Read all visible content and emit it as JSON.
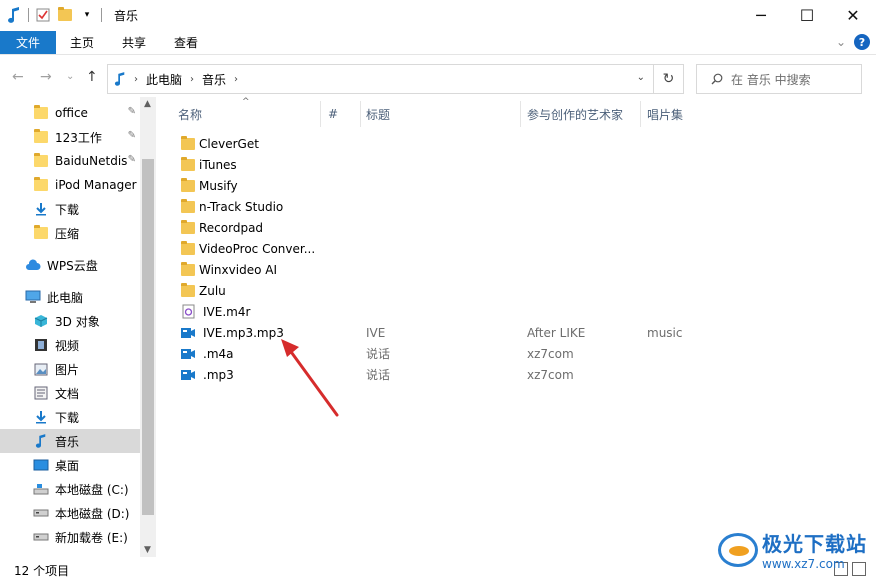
{
  "window": {
    "title": "音乐",
    "controls": {
      "minimize": "─",
      "maximize": "☐",
      "close": "✕"
    }
  },
  "ribbon": {
    "tabs": [
      "文件",
      "主页",
      "共享",
      "查看"
    ],
    "collapse_glyph": "⌄",
    "help_glyph": "?"
  },
  "address": {
    "back": "←",
    "forward": "→",
    "recent": "⌄",
    "up": "↑",
    "segments": [
      "此电脑",
      "音乐"
    ],
    "separator": "›",
    "dropdown": "⌄",
    "refresh": "↻"
  },
  "search": {
    "placeholder": "在 音乐 中搜索"
  },
  "nav": {
    "items": [
      {
        "label": "office",
        "icon": "folder-icon",
        "pinned": true
      },
      {
        "label": "123工作",
        "icon": "folder-icon",
        "pinned": true
      },
      {
        "label": "BaiduNetdis",
        "icon": "folder-icon",
        "pinned": true
      },
      {
        "label": "iPod Manager",
        "icon": "folder-icon",
        "pinned": false
      },
      {
        "label": "下载",
        "icon": "download-icon",
        "pinned": false
      },
      {
        "label": "压缩",
        "icon": "folder-icon",
        "pinned": false
      },
      {
        "label": "WPS云盘",
        "icon": "cloud-icon",
        "pinned": false
      },
      {
        "label": "此电脑",
        "icon": "computer-icon",
        "pinned": false
      },
      {
        "label": "3D 对象",
        "icon": "cube-icon",
        "pinned": false
      },
      {
        "label": "视频",
        "icon": "video-icon",
        "pinned": false
      },
      {
        "label": "图片",
        "icon": "picture-icon",
        "pinned": false
      },
      {
        "label": "文档",
        "icon": "document-icon",
        "pinned": false
      },
      {
        "label": "下载",
        "icon": "download-icon",
        "pinned": false
      },
      {
        "label": "音乐",
        "icon": "music-icon",
        "pinned": false,
        "selected": true
      },
      {
        "label": "桌面",
        "icon": "desktop-icon",
        "pinned": false
      },
      {
        "label": "本地磁盘 (C:)",
        "icon": "drive-c-icon",
        "pinned": false
      },
      {
        "label": "本地磁盘 (D:)",
        "icon": "drive-icon",
        "pinned": false
      },
      {
        "label": "新加载卷 (E:)",
        "icon": "drive-icon",
        "pinned": false
      }
    ],
    "pin_glyph": "📌"
  },
  "columns": {
    "name": "名称",
    "number": "#",
    "title": "标题",
    "artist": "参与创作的艺术家",
    "album": "唱片集"
  },
  "files": [
    {
      "name": "CleverGet",
      "type": "folder",
      "title": "",
      "artist": "",
      "album": ""
    },
    {
      "name": "iTunes",
      "type": "folder",
      "title": "",
      "artist": "",
      "album": ""
    },
    {
      "name": "Musify",
      "type": "folder",
      "title": "",
      "artist": "",
      "album": ""
    },
    {
      "name": "n-Track Studio",
      "type": "folder",
      "title": "",
      "artist": "",
      "album": ""
    },
    {
      "name": "Recordpad",
      "type": "folder",
      "title": "",
      "artist": "",
      "album": ""
    },
    {
      "name": "VideoProc Conver...",
      "type": "folder",
      "title": "",
      "artist": "",
      "album": ""
    },
    {
      "name": "Winxvideo AI",
      "type": "folder",
      "title": "",
      "artist": "",
      "album": ""
    },
    {
      "name": "Zulu",
      "type": "folder",
      "title": "",
      "artist": "",
      "album": ""
    },
    {
      "name": "IVE.m4r",
      "type": "ringtone",
      "title": "",
      "artist": "",
      "album": ""
    },
    {
      "name": "IVE.mp3.mp3",
      "type": "media",
      "title": "IVE",
      "artist": "After LIKE",
      "album": "music"
    },
    {
      "name": ".m4a",
      "type": "media",
      "title": "说话",
      "artist": "xz7com",
      "album": ""
    },
    {
      "name": ".mp3",
      "type": "media",
      "title": "说话",
      "artist": "xz7com",
      "album": ""
    }
  ],
  "status": {
    "count": "12 个项目"
  },
  "watermark": {
    "brand": "极光下载站",
    "url": "www.xz7.com"
  },
  "colors": {
    "accent": "#1979ca",
    "folder": "#f3c654",
    "selected": "#d9d9d9",
    "arrow": "#d62c2c"
  }
}
